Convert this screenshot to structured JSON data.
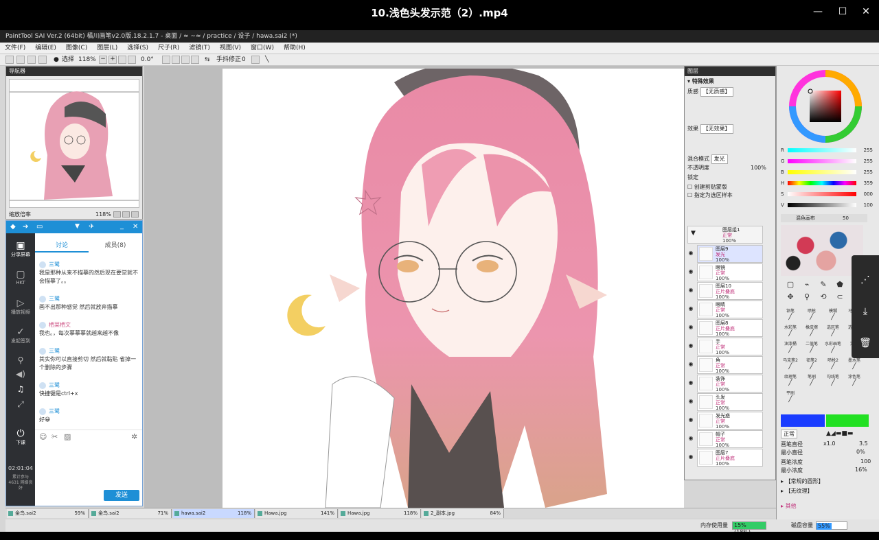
{
  "player": {
    "title": "10.浅色头发示范（2）.mp4",
    "minimize": "—",
    "maximize": "☐",
    "close": "✕"
  },
  "sai": {
    "title": "PaintTool SAI Ver.2 (64bit) 橘川画笔v2.0版.18.2.1.7 - 桌面 / ≈ ~≈ / practice / 设子 / hawa.sai2 (*)",
    "menu": [
      "文件(F)",
      "编辑(E)",
      "图像(C)",
      "图层(L)",
      "选择(S)",
      "尺子(R)",
      "滤镜(T)",
      "视图(V)",
      "窗口(W)",
      "帮助(H)"
    ],
    "toolbar": {
      "select_label": "选择",
      "zoom": "118%",
      "angle": "0.0°",
      "stabilizer_label": "手抖修正",
      "stabilizer_value": "0"
    },
    "navigator": {
      "title": "导航器",
      "zoom_label": "缩放倍率",
      "zoom_value": "118%"
    },
    "layers": {
      "title": "图层",
      "effects_header": "特殊效果",
      "texture_label": "质感",
      "texture_value": "【无质感】",
      "effect_label": "效果",
      "effect_value": "【无效果】",
      "blend_label": "混合模式",
      "blend_value": "发光",
      "opacity_label": "不透明度",
      "opacity_value": "100%",
      "lock_label": "锁定",
      "clip_label": "创建剪贴蒙版",
      "ref_label": "指定为选区样本",
      "group": {
        "name": "图层组1",
        "mode": "正常",
        "opacity": "100%"
      },
      "items": [
        {
          "name": "图层9",
          "mode": "发光",
          "opacity": "100%"
        },
        {
          "name": "眼镜",
          "mode": "正常",
          "opacity": "100%"
        },
        {
          "name": "图层10",
          "mode": "正片叠底",
          "opacity": "100%"
        },
        {
          "name": "眼睛",
          "mode": "正常",
          "opacity": "100%"
        },
        {
          "name": "图层8",
          "mode": "正片叠底",
          "opacity": "100%"
        },
        {
          "name": "手",
          "mode": "正常",
          "opacity": "100%"
        },
        {
          "name": "角",
          "mode": "正常",
          "opacity": "100%"
        },
        {
          "name": "装饰",
          "mode": "正常",
          "opacity": "100%"
        },
        {
          "name": "头发",
          "mode": "正常",
          "opacity": "100%"
        },
        {
          "name": "发光惑",
          "mode": "正常",
          "opacity": "100%"
        },
        {
          "name": "帽子",
          "mode": "正常",
          "opacity": "100%"
        },
        {
          "name": "图层7",
          "mode": "正片叠底",
          "opacity": "100%"
        }
      ]
    },
    "color": {
      "sliders": [
        {
          "label": "R",
          "value": "255"
        },
        {
          "label": "G",
          "value": "255"
        },
        {
          "label": "B",
          "value": "255"
        },
        {
          "label": "H",
          "value": "359"
        },
        {
          "label": "S",
          "value": "000"
        },
        {
          "label": "V",
          "value": "100"
        }
      ],
      "mixer_label": "混色画布",
      "mixer_value": "50"
    },
    "tools": [
      "铅笔",
      "喷枪",
      "模糊",
      "马克笔",
      "水彩笔",
      "橡皮擦",
      "选区笔",
      "选区擦",
      "油漆桶",
      "二值笔",
      "水彩画笔",
      "涂抹",
      "马克笔2",
      "铅笔2",
      "喷枪2",
      "墨水笔",
      "纹理笔",
      "笔刷",
      "勾线笔",
      "涂色笔",
      "平刷"
    ],
    "brush": {
      "mode": "正常",
      "size_label": "画笔直径",
      "size_mult": "x1.0",
      "size_value": "3.5",
      "min_size_label": "最小直径",
      "min_size_value": "0%",
      "density_label": "画笔浓度",
      "density_value": "100",
      "min_density_label": "最小浓度",
      "min_density_value": "16%",
      "shape_label": "【常规的圆形】",
      "texture_label": "【无纹理】",
      "other_label": "其他"
    },
    "tabs": [
      {
        "name": "金鸟.sai2",
        "zoom": "59%"
      },
      {
        "name": "金鸟.sai2",
        "zoom": "71%"
      },
      {
        "name": "hawa.sai2",
        "zoom": "118%"
      },
      {
        "name": "Hawa.jpg",
        "zoom": "141%"
      },
      {
        "name": "Hawa.jpg",
        "zoom": "118%"
      },
      {
        "name": "2_副本.jpg",
        "zoom": "84%"
      }
    ],
    "status": {
      "memory_label": "内存使用量",
      "memory_value": "15% (18%)",
      "disk_label": "磁盘容量",
      "disk_value": "55%"
    }
  },
  "chat": {
    "tabs": [
      "讨论",
      "成员(8)"
    ],
    "side": [
      "分享屏幕",
      "HKT",
      "播放视频",
      "发起签到",
      "",
      "",
      "",
      "",
      "下课"
    ],
    "timer": "02:01:04",
    "stats": "累计参与 4631 网络良好",
    "messages": [
      {
        "who": "三鹭",
        "text": "我是那种从来不描摹的然后现在要觉就不会描摹了。。"
      },
      {
        "who": "三鹭",
        "text": "画不出那种感觉   然后就放弃描摹"
      },
      {
        "who": "栖菜栖文",
        "text": "我也。，每次摹摹摹就越来越不像"
      },
      {
        "who": "三鹭",
        "text": "其实你可以直接剪切  然后就黏贴  省掉一个删除的步骤"
      },
      {
        "who": "三鹭",
        "text": "快捷键是ctrl+x"
      },
      {
        "who": "三鹭",
        "text": "好😀"
      }
    ],
    "send_label": "发送"
  },
  "colors": {
    "accent": "#1e8fd6",
    "fg_color": "#1a3cff",
    "bg_color": "#22e022",
    "hair": "#e98aa6"
  }
}
